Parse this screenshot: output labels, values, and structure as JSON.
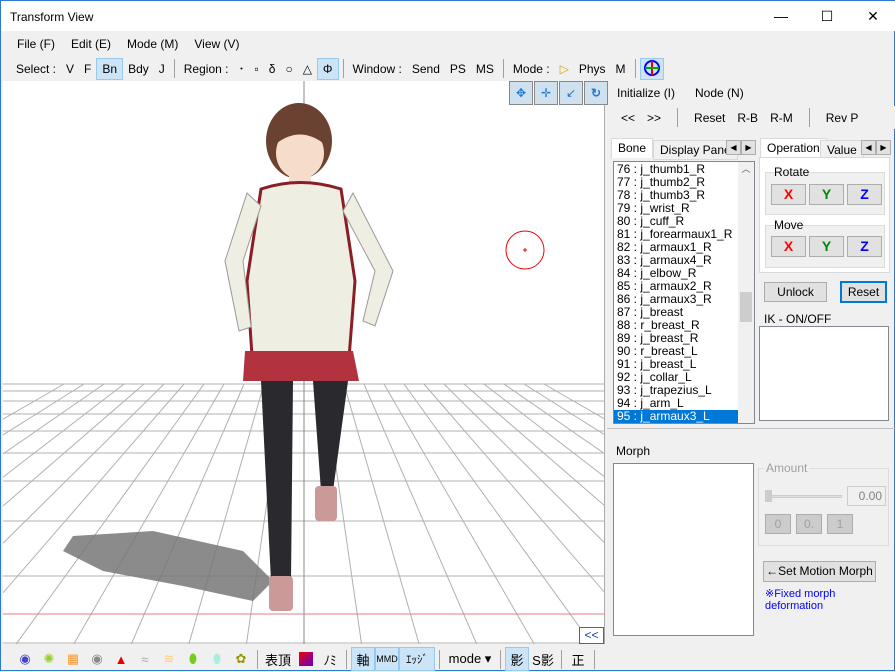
{
  "window": {
    "title": "Transform View",
    "minimize": "—",
    "maximize": "☐",
    "close": "✕"
  },
  "menu": [
    "File (F)",
    "Edit (E)",
    "Mode (M)",
    "View (V)"
  ],
  "toolbar": {
    "select_label": "Select :",
    "select": [
      "V",
      "F",
      "Bn",
      "Bdy",
      "J"
    ],
    "select_active": "Bn",
    "region_label": "Region :",
    "region": [
      "･",
      "▫",
      "δ",
      "○",
      "△",
      "Φ"
    ],
    "region_active": "Φ",
    "window_label": "Window :",
    "window": [
      "Send",
      "PS",
      "MS"
    ],
    "mode_label": "Mode :",
    "mode": [
      "▷",
      "Phys",
      "M"
    ],
    "gizmo_icon": "local-axis-icon"
  },
  "viewport": {
    "camera_icons": [
      "rotate-icon",
      "move-icon",
      "zoom-icon",
      "turn-icon"
    ],
    "collapse_label": "<<"
  },
  "right_panel": {
    "menu": [
      "Initialize (I)",
      "Node (N)"
    ],
    "nav": [
      "<<",
      ">>"
    ],
    "actions": [
      "Reset",
      "R-B",
      "R-M"
    ],
    "rev": "Rev P",
    "left_tabs": [
      "Bone",
      "Display Pane"
    ],
    "right_tabs": [
      "Operation",
      "Value"
    ],
    "bones": [
      "76 : j_thumb1_R",
      "77 : j_thumb2_R",
      "78 : j_thumb3_R",
      "79 : j_wrist_R",
      "80 : j_cuff_R",
      "81 : j_forearmaux1_R",
      "82 : j_armaux1_R",
      "83 : j_armaux4_R",
      "84 : j_elbow_R",
      "85 : j_armaux2_R",
      "86 : j_armaux3_R",
      "87 : j_breast",
      "88 : r_breast_R",
      "89 : j_breast_R",
      "90 : r_breast_L",
      "91 : j_breast_L",
      "92 : j_collar_L",
      "93 : j_trapezius_L",
      "94 : j_arm_L",
      "95 : j_armaux3_L"
    ],
    "selected_bone": "95 : j_armaux3_L",
    "rotate_label": "Rotate",
    "move_label": "Move",
    "axes": [
      "X",
      "Y",
      "Z"
    ],
    "axis_colors": [
      "#ff0000",
      "#008000",
      "#0000ff"
    ],
    "unlock": "Unlock",
    "reset": "Reset",
    "ik_label": "IK - ON/OFF",
    "morph_label": "Morph",
    "amount_label": "Amount",
    "amount_value": "0.00",
    "amount_buttons": [
      "0",
      "0.",
      "1"
    ],
    "set_motion_morph": "←Set Motion Morph",
    "fixed_morph_note": "※Fixed morph deformation"
  },
  "bottom": {
    "text_buttons": [
      "表頂",
      "ﾉﾐ",
      "軸",
      "MMD",
      "ｴｯｼﾞ",
      "mode ▾",
      "影",
      "S影",
      "正"
    ]
  }
}
